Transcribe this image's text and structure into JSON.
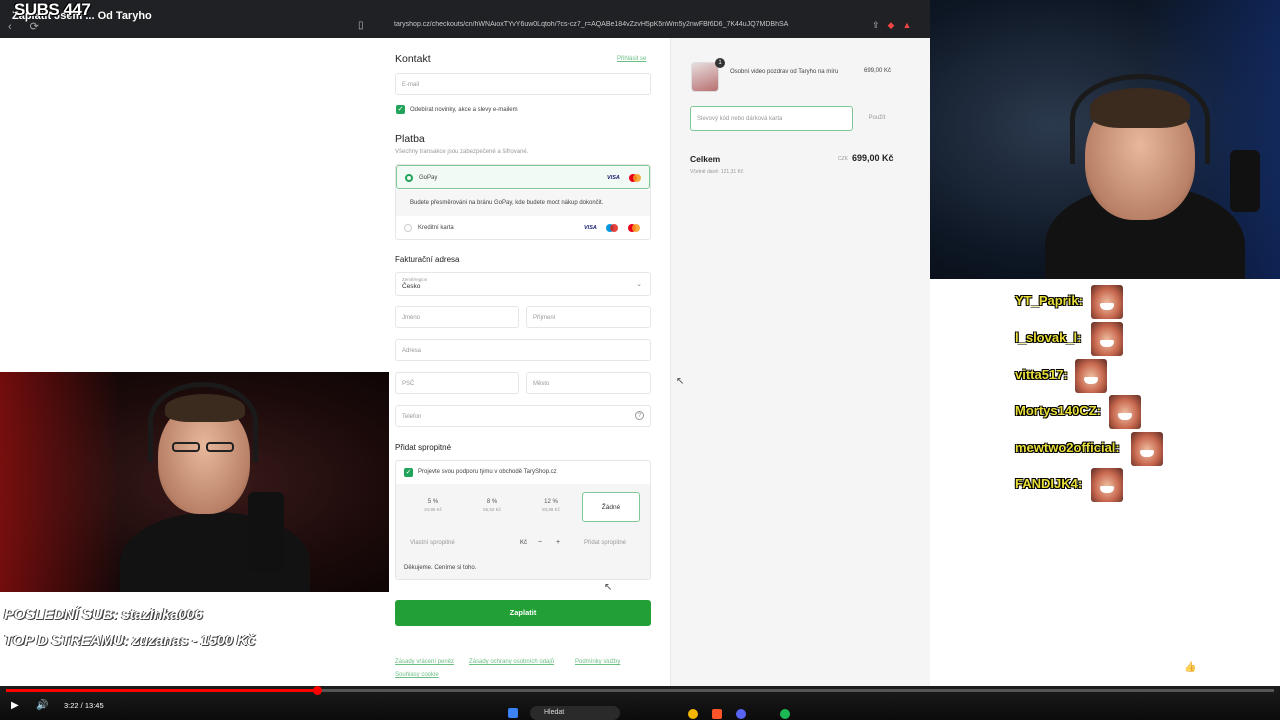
{
  "browser": {
    "tab_title": "Zaplatit Jsem ... Od Taryho",
    "subs_counter": "SUBS 447",
    "address": "taryshop.cz/checkouts/cn/hWNAioxTYvY6uw0Lqtoh/?cs-cz7_r=AQABe184vZzvH5pK5nWm5y2nwFBf6D6_7K44uJQ7MDBhSA",
    "nav_icons": [
      "back-icon",
      "reload-icon"
    ]
  },
  "checkout": {
    "contact": {
      "heading": "Kontakt",
      "login_link": "Přihlásit se",
      "email_placeholder": "E-mail",
      "newsletter_label": "Odebírat novinky, akce a slevy e-mailem"
    },
    "payment": {
      "heading": "Platba",
      "subtitle": "Všechny transakce jsou zabezpečené a šifrované.",
      "gopay_label": "GoPay",
      "gopay_info": "Budete přesměrováni na bránu GoPay, kde budete moct nákup dokončit.",
      "card_label": "Kreditní karta",
      "visa": "VISA"
    },
    "billing": {
      "heading": "Fakturační adresa",
      "country_label": "Země/region",
      "country_value": "Česko",
      "first_name": "Jméno",
      "last_name": "Příjmení",
      "address": "Adresa",
      "zip": "PSČ",
      "city": "Město",
      "phone": "Telefon"
    },
    "tip": {
      "heading": "Přidat spropitné",
      "support_label": "Projevte svou podporu týmu v obchodě TaryShop.cz",
      "options": [
        {
          "pct": "5 %",
          "amount": "34,95 Kč"
        },
        {
          "pct": "8 %",
          "amount": "55,92 Kč"
        },
        {
          "pct": "12 %",
          "amount": "83,88 Kč"
        }
      ],
      "none_label": "Žádné",
      "custom_placeholder": "Vlastní spropitné",
      "currency": "Kč",
      "minus": "−",
      "plus": "+",
      "add_tip": "Přidat spropitné",
      "thanks": "Děkujeme. Ceníme si toho."
    },
    "pay_button": "Zaplatit",
    "footer_links": [
      "Zásady vrácení peněz",
      "Zásady ochrany osobních údajů",
      "Podmínky služby",
      "Souhlasy cookie"
    ]
  },
  "summary": {
    "item_name": "Osobní video pozdrav od Taryho na míru",
    "item_qty": "1",
    "item_price": "699,00 Kč",
    "discount_placeholder": "Slevový kód nebo dárková karta",
    "apply": "Použít",
    "total_label": "Celkem",
    "total_currency": "CZK",
    "total_value": "699,00 Kč",
    "tax_note": "Včetně daně: 121,31 Kč"
  },
  "overlay": {
    "last_sub": "POSLEDNÍ SUB: stazinka006",
    "top_stream": "TOP D STREAMU: zuzanas - 1500 Kč"
  },
  "chat": [
    {
      "name": "YT_Paprik:"
    },
    {
      "name": "l_slovak_l:"
    },
    {
      "name": "vitta517:"
    },
    {
      "name": "Mortys140CZ:"
    },
    {
      "name": "mewtwo2official:"
    },
    {
      "name": "FANDIJK4:"
    }
  ],
  "player": {
    "time": "3:22 / 13:45",
    "progress_fraction": 0.245,
    "taskbar_search": "Hledat"
  }
}
